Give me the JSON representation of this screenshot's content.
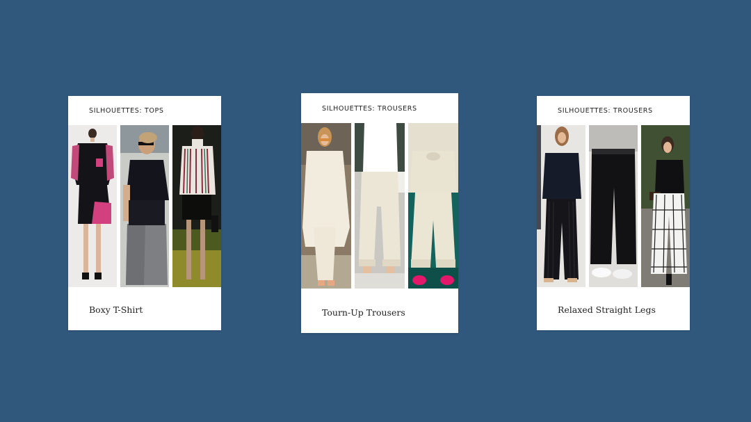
{
  "background_color": "#30587c",
  "cards": [
    {
      "label": "SILHOUETTES: TOPS",
      "title": "Boxy T-Shirt",
      "photos": [
        "model-black-pink-tee-photo",
        "model-navy-tee-gray-pants-photo",
        "model-striped-top-photo"
      ]
    },
    {
      "label": "SILHOUETTES: TROUSERS",
      "title": "Tourn-Up Trousers",
      "photos": [
        "model-cream-coat-photo",
        "model-cream-cuffed-trousers-photo",
        "model-cream-suit-pink-shoes-photo"
      ]
    },
    {
      "label": "SILHOUETTES: TROUSERS",
      "title": "Relaxed Straight Legs",
      "photos": [
        "model-black-outfit-photo",
        "model-wide-black-trousers-photo",
        "model-windowpane-trousers-photo"
      ]
    }
  ]
}
